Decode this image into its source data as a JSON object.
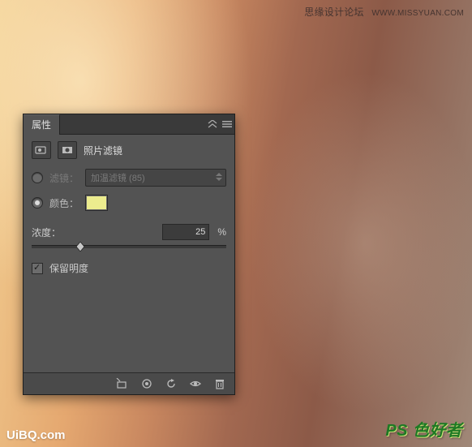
{
  "watermark": {
    "top_text": "思缘设计论坛",
    "top_url": "WWW.MISSYUAN.COM",
    "bottom_left": "UiBQ.com",
    "bottom_right": "PS 色好者"
  },
  "panel": {
    "tab": "属性",
    "title": "照片滤镜",
    "filter_label": "滤镜：",
    "filter_value": "加温滤镜 (85)",
    "color_label": "颜色：",
    "color_value": "#ecec8e",
    "density_label": "浓度：",
    "density_value": "25",
    "density_unit": "%",
    "preserve_label": "保留明度"
  }
}
